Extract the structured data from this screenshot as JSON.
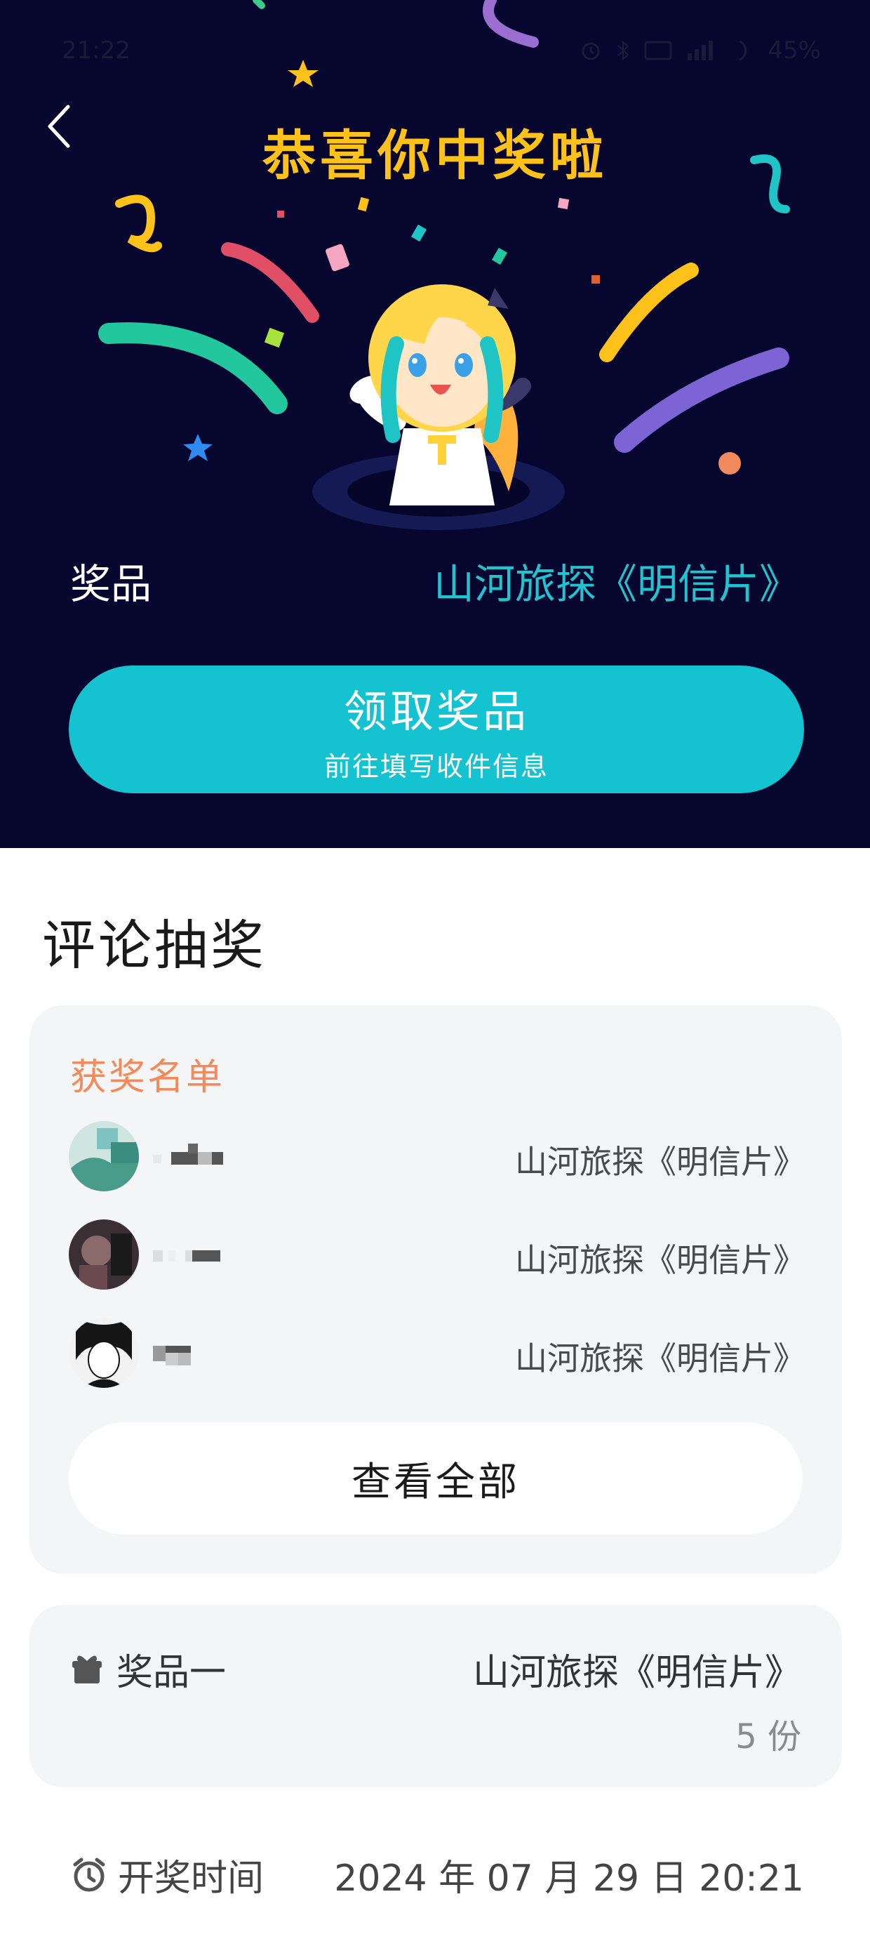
{
  "status_bar": {
    "time": "21:22",
    "battery": "45%",
    "icons": [
      "alarm-icon",
      "bluetooth-icon",
      "hd-icon",
      "signal-icon",
      "battery-icon"
    ]
  },
  "hero": {
    "title": "恭喜你中奖啦",
    "prize_label": "奖品",
    "prize_value": "山河旅探《明信片》",
    "claim_button": {
      "label": "领取奖品",
      "sublabel": "前往填写收件信息"
    }
  },
  "lottery": {
    "section_title": "评论抽奖",
    "winners": {
      "title": "获奖名单",
      "rows": [
        {
          "prize": "山河旅探《明信片》"
        },
        {
          "prize": "山河旅探《明信片》"
        },
        {
          "prize": "山河旅探《明信片》"
        }
      ],
      "view_all": "查看全部"
    },
    "prize_card": {
      "label": "奖品一",
      "value": "山河旅探《明信片》",
      "count": "5 份"
    },
    "draw_time": {
      "label": "开奖时间",
      "value": "2024 年 07 月 29 日 20:21"
    }
  },
  "colors": {
    "hero_bg": "#07062e",
    "title_yellow": "#ffc21a",
    "accent_cyan": "#15c2cf",
    "winners_orange": "#f28a5b",
    "card_bg": "#f4f5f7"
  }
}
